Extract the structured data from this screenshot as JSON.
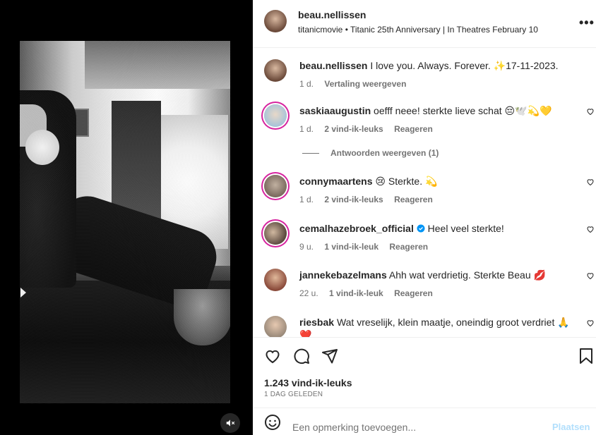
{
  "post": {
    "username": "beau.nellissen",
    "audio": "titanicmovie • Titanic 25th Anniversary | In Theatres February 10",
    "more_label": "•••",
    "caption": {
      "username": "beau.nellissen",
      "text": "I love you. Always. Forever. ✨17-11-2023.",
      "time": "1 d.",
      "translate": "Vertaling weergeven"
    }
  },
  "comments": [
    {
      "username": "saskiaaugustin",
      "text": "oefff neee! sterkte lieve schat 😔🕊️💫💛",
      "time": "1 d.",
      "likes": "2 vind-ik-leuks",
      "reply": "Reageren",
      "avatar_color": "#a8c4d8",
      "ring": true
    },
    {
      "username": "connymaartens",
      "text": "😢 Sterkte. 💫",
      "time": "1 d.",
      "likes": "2 vind-ik-leuks",
      "reply": "Reageren",
      "avatar_color": "#7a6a5e",
      "ring": true
    },
    {
      "username": "cemalhazebroek_official",
      "text": "Heel veel sterkte!",
      "time": "9 u.",
      "likes": "1 vind-ik-leuk",
      "reply": "Reageren",
      "avatar_color": "#5b4a3f",
      "ring": true,
      "verified": true
    },
    {
      "username": "jannekebazelmans",
      "text": "Ahh wat verdrietig. Sterkte Beau 💋",
      "time": "22 u.",
      "likes": "1 vind-ik-leuk",
      "reply": "Reageren",
      "avatar_color": "#8a4a3a",
      "ring": false
    },
    {
      "username": "riesbak",
      "text": "Wat vreselijk, klein maatje, oneindig groot verdriet 🙏❤️",
      "time": "",
      "likes": "",
      "reply": "",
      "avatar_color": "#9a8a7a",
      "ring": false
    }
  ],
  "replies_toggle": "Antwoorden weergeven (1)",
  "engagement": {
    "likes": "1.243 vind-ik-leuks",
    "date": "1 DAG GELEDEN"
  },
  "composer": {
    "placeholder": "Een opmerking toevoegen...",
    "post_label": "Plaatsen"
  },
  "icons": [
    "heart-icon",
    "comment-icon",
    "share-icon",
    "bookmark-icon",
    "emoji-icon",
    "mute-icon",
    "more-icon",
    "verified-icon"
  ],
  "colors": {
    "accent_ring": "#d6249f",
    "verified": "#0095f6",
    "post_button_disabled": "#b2dffc",
    "secondary_text": "#737373"
  }
}
